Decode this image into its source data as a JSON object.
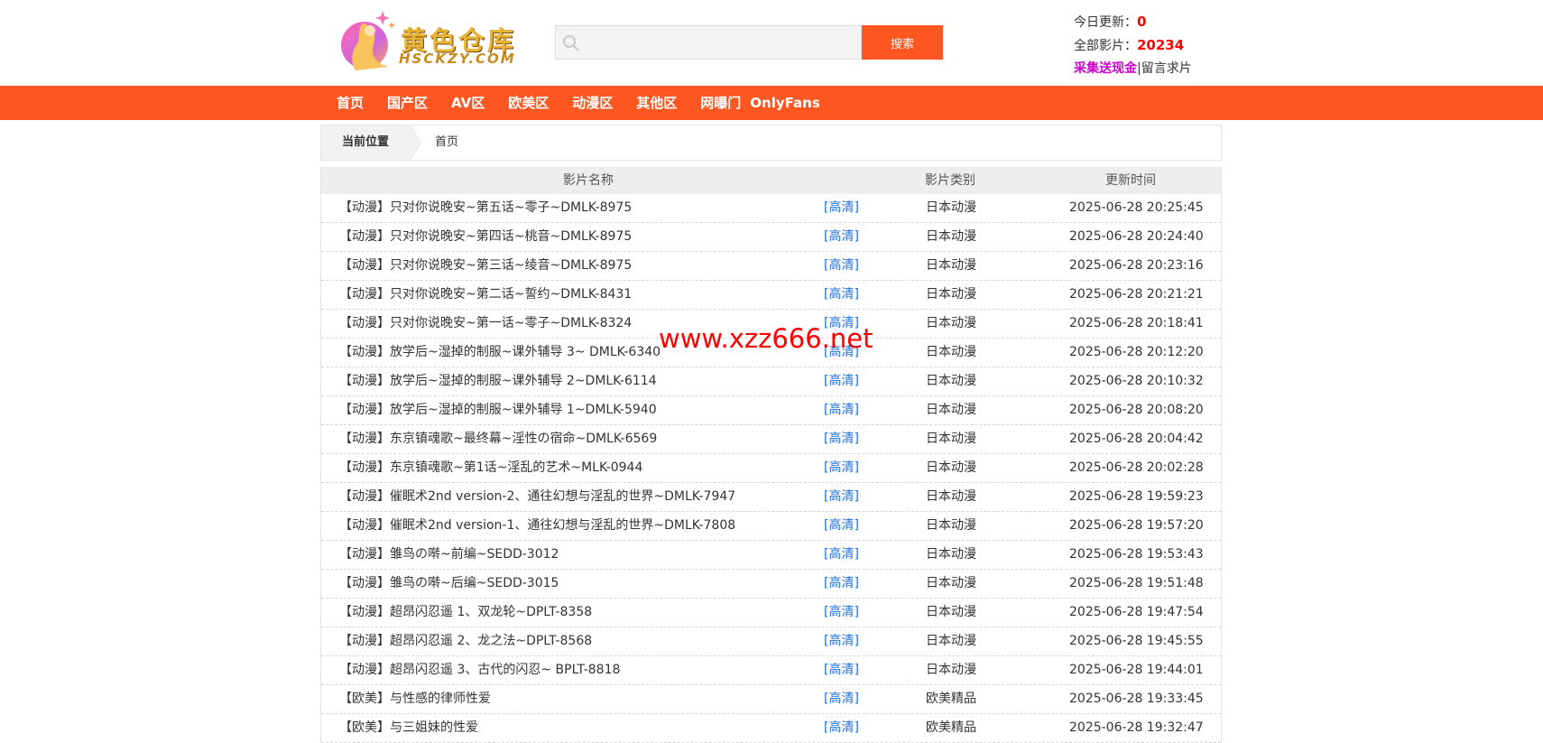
{
  "header": {
    "logo_text": "黄色仓库",
    "logo_sub": "HSCKZY.COM",
    "search": {
      "placeholder": "",
      "value": "",
      "button_label": "搜索"
    },
    "stats": {
      "today_label": "今日更新：",
      "today_value": "0",
      "total_label": "全部影片：",
      "total_value": "20234",
      "promo_link": "采集送现金",
      "separator": "|",
      "message_link": "留言求片"
    }
  },
  "nav": {
    "items": [
      "首页",
      "国产区",
      "AV区",
      "欧美区",
      "动漫区",
      "其他区",
      "网曝门",
      "OnlyFans"
    ]
  },
  "breadcrumb": {
    "label": "当前位置",
    "home": "首页"
  },
  "table": {
    "headers": {
      "name": "影片名称",
      "category": "影片类别",
      "time": "更新时间"
    },
    "rows": [
      {
        "title": "【动漫】只对你说晚安~第五话~零子~DMLK-8975",
        "quality": "[高清]",
        "category": "日本动漫",
        "time": "2025-06-28 20:25:45"
      },
      {
        "title": "【动漫】只对你说晚安~第四话~桃音~DMLK-8975",
        "quality": "[高清]",
        "category": "日本动漫",
        "time": "2025-06-28 20:24:40"
      },
      {
        "title": "【动漫】只对你说晚安~第三话~绫音~DMLK-8975",
        "quality": "[高清]",
        "category": "日本动漫",
        "time": "2025-06-28 20:23:16"
      },
      {
        "title": "【动漫】只对你说晚安~第二话~誓约~DMLK-8431",
        "quality": "[高清]",
        "category": "日本动漫",
        "time": "2025-06-28 20:21:21"
      },
      {
        "title": "【动漫】只对你说晚安~第一话~零子~DMLK-8324",
        "quality": "[高清]",
        "category": "日本动漫",
        "time": "2025-06-28 20:18:41"
      },
      {
        "title": "【动漫】放学后~湿掉的制服~课外辅导 3~ DMLK-6340",
        "quality": "[高清]",
        "category": "日本动漫",
        "time": "2025-06-28 20:12:20"
      },
      {
        "title": "【动漫】放学后~湿掉的制服~课外辅导 2~DMLK-6114",
        "quality": "[高清]",
        "category": "日本动漫",
        "time": "2025-06-28 20:10:32"
      },
      {
        "title": "【动漫】放学后~湿掉的制服~课外辅导 1~DMLK-5940",
        "quality": "[高清]",
        "category": "日本动漫",
        "time": "2025-06-28 20:08:20"
      },
      {
        "title": "【动漫】东京镇魂歌~最终幕~淫性の宿命~DMLK-6569",
        "quality": "[高清]",
        "category": "日本动漫",
        "time": "2025-06-28 20:04:42"
      },
      {
        "title": "【动漫】东京镇魂歌~第1话~淫乱的艺术~MLK-0944",
        "quality": "[高清]",
        "category": "日本动漫",
        "time": "2025-06-28 20:02:28"
      },
      {
        "title": "【动漫】催眠术2nd version-2、通往幻想与淫乱的世界~DMLK-7947",
        "quality": "[高清]",
        "category": "日本动漫",
        "time": "2025-06-28 19:59:23"
      },
      {
        "title": "【动漫】催眠术2nd version-1、通往幻想与淫乱的世界~DMLK-7808",
        "quality": "[高清]",
        "category": "日本动漫",
        "time": "2025-06-28 19:57:20"
      },
      {
        "title": "【动漫】雏鸟の啭~前编~SEDD-3012",
        "quality": "[高清]",
        "category": "日本动漫",
        "time": "2025-06-28 19:53:43"
      },
      {
        "title": "【动漫】雏鸟の啭~后编~SEDD-3015",
        "quality": "[高清]",
        "category": "日本动漫",
        "time": "2025-06-28 19:51:48"
      },
      {
        "title": "【动漫】超昂闪忍遥 1、双龙轮~DPLT-8358",
        "quality": "[高清]",
        "category": "日本动漫",
        "time": "2025-06-28 19:47:54"
      },
      {
        "title": "【动漫】超昂闪忍遥 2、龙之法~DPLT-8568",
        "quality": "[高清]",
        "category": "日本动漫",
        "time": "2025-06-28 19:45:55"
      },
      {
        "title": "【动漫】超昂闪忍遥 3、古代的闪忍~ BPLT-8818",
        "quality": "[高清]",
        "category": "日本动漫",
        "time": "2025-06-28 19:44:01"
      },
      {
        "title": "【欧美】与性感的律师性爱",
        "quality": "[高清]",
        "category": "欧美精品",
        "time": "2025-06-28 19:33:45"
      },
      {
        "title": "【欧美】与三姐妹的性爱",
        "quality": "[高清]",
        "category": "欧美精品",
        "time": "2025-06-28 19:32:47"
      }
    ]
  },
  "watermark": "www.xzz666.net",
  "colors": {
    "accent": "#fe5722",
    "link_blue": "#1e6fd9",
    "stat_red": "#ff0000",
    "promo_purple": "#cc00cc"
  }
}
